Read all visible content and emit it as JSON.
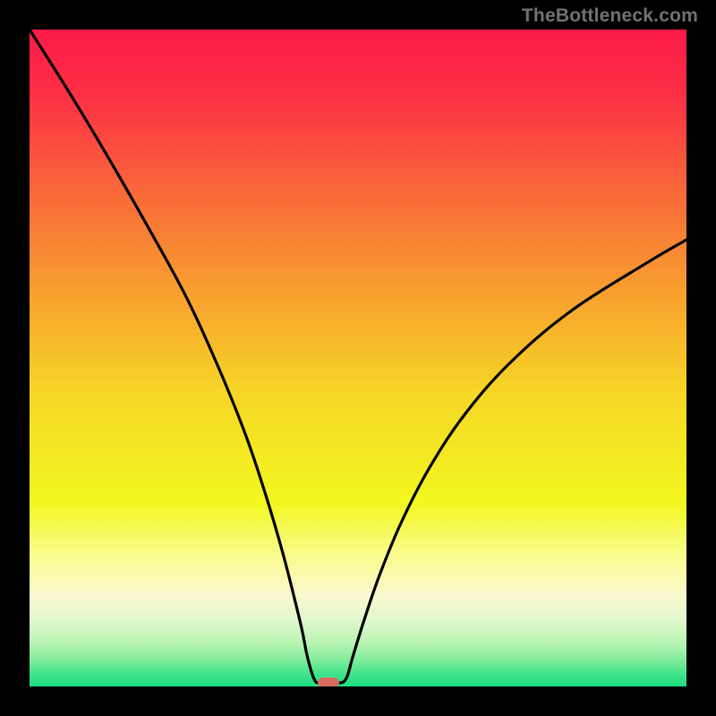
{
  "attribution": "TheBottleneck.com",
  "chart_data": {
    "type": "line",
    "title": "",
    "xlabel": "",
    "ylabel": "",
    "xlim": [
      0,
      100
    ],
    "ylim": [
      0,
      100
    ],
    "x": [
      0,
      6,
      12,
      18,
      24,
      29,
      33,
      36,
      38.5,
      40.3,
      41.5,
      42.3,
      43.3,
      44.2,
      46.9,
      48.2,
      49.2,
      50.9,
      53.3,
      56.6,
      61,
      66.7,
      73.9,
      82.9,
      94,
      100
    ],
    "values": [
      100,
      90.5,
      80.5,
      70,
      59,
      48,
      38,
      29,
      20.5,
      13.5,
      8.5,
      4.5,
      1.2,
      0.5,
      0.5,
      1.2,
      4.5,
      10,
      17,
      25,
      33.5,
      42,
      50,
      57.5,
      64.5,
      68
    ],
    "marker": {
      "x": 45.5,
      "y": 0.6,
      "color": "#d86a60"
    },
    "gradient_stops": [
      {
        "pos": 0.0,
        "color": "#fd1a48"
      },
      {
        "pos": 0.1,
        "color": "#fc3044"
      },
      {
        "pos": 0.25,
        "color": "#f96939"
      },
      {
        "pos": 0.4,
        "color": "#f89f2f"
      },
      {
        "pos": 0.55,
        "color": "#f6d526"
      },
      {
        "pos": 0.72,
        "color": "#f2f71f"
      },
      {
        "pos": 0.8,
        "color": "#f9fc8d"
      },
      {
        "pos": 0.86,
        "color": "#faf8ce"
      },
      {
        "pos": 0.9,
        "color": "#e0f7cd"
      },
      {
        "pos": 0.935,
        "color": "#b8f5b2"
      },
      {
        "pos": 0.96,
        "color": "#7fec9a"
      },
      {
        "pos": 0.98,
        "color": "#44e48b"
      },
      {
        "pos": 1.0,
        "color": "#1bdd82"
      }
    ]
  }
}
